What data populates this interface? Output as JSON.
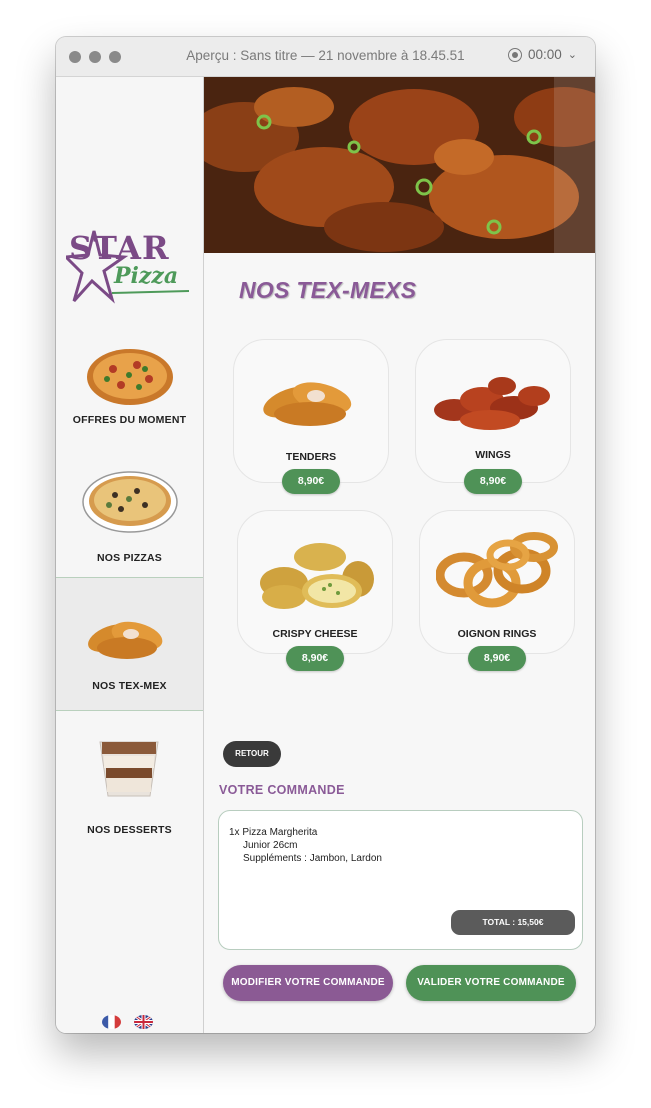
{
  "window": {
    "title": "Aperçu : Sans titre — 21 novembre à 18.45.51",
    "timer": "00:00"
  },
  "sidebar": {
    "logo": {
      "line1": "STAR",
      "line2": "Pizza"
    },
    "items": [
      {
        "label": "OFFRES DU MOMENT",
        "icon": "pizza-image"
      },
      {
        "label": "NOS PIZZAS",
        "icon": "pizza-plate-image"
      },
      {
        "label": "NOS TEX-MEX",
        "icon": "tenders-image",
        "active": true
      },
      {
        "label": "NOS DESSERTS",
        "icon": "tiramisu-image"
      }
    ],
    "languages": [
      "fr-flag-icon",
      "uk-flag-icon"
    ]
  },
  "main": {
    "section_title": "NOS TEX-MEXS",
    "products": [
      {
        "name": "TENDERS",
        "price": "8,90€"
      },
      {
        "name": "WINGS",
        "price": "8,90€"
      },
      {
        "name": "CRISPY CHEESE",
        "price": "8,90€"
      },
      {
        "name": "OIGNON RINGS",
        "price": "8,90€"
      }
    ],
    "back_label": "RETOUR",
    "order": {
      "title": "VOTRE COMMANDE",
      "item": "1x Pizza Margherita",
      "size": "Junior 26cm",
      "extras": "Suppléments : Jambon, Lardon",
      "total": "TOTAL : 15,50€"
    },
    "modify_label": "MODIFIER VOTRE COMMANDE",
    "validate_label": "VALIDER VOTRE COMMANDE"
  },
  "colors": {
    "accent_purple": "#8a5a97",
    "accent_green": "#4f9257",
    "dark_button": "#3a3a3a"
  }
}
